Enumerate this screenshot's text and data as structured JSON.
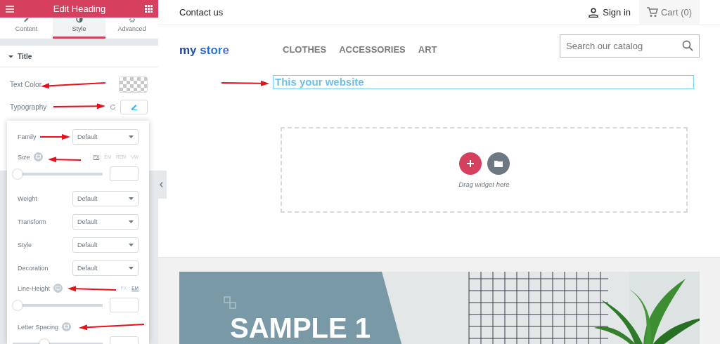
{
  "panel": {
    "title": "Edit Heading",
    "tabs": [
      {
        "label": "Content",
        "selected": false
      },
      {
        "label": "Style",
        "selected": true
      },
      {
        "label": "Advanced",
        "selected": false
      }
    ],
    "section": {
      "title": "Title",
      "expanded": true
    },
    "fields": [
      {
        "kind": "color",
        "label": "Text Color"
      },
      {
        "kind": "typography",
        "label": "Typography"
      }
    ],
    "typography": [
      {
        "kind": "select",
        "label": "Family",
        "value": "Default"
      },
      {
        "kind": "slider",
        "label": "Size",
        "units": [
          {
            "label": "PX",
            "selected": true
          },
          {
            "label": "EM",
            "selected": false
          },
          {
            "label": "REM",
            "selected": false
          },
          {
            "label": "VW",
            "selected": false
          }
        ],
        "level": 0
      },
      {
        "kind": "select",
        "label": "Weight",
        "value": "Default"
      },
      {
        "kind": "select",
        "label": "Transform",
        "value": "Default"
      },
      {
        "kind": "select",
        "label": "Style",
        "value": "Default"
      },
      {
        "kind": "select",
        "label": "Decoration",
        "value": "Default"
      },
      {
        "kind": "slider",
        "label": "Line-Height",
        "units": [
          {
            "label": "PX",
            "selected": false
          },
          {
            "label": "EM",
            "selected": true
          }
        ],
        "level": 0
      },
      {
        "kind": "slider",
        "label": "Letter Spacing",
        "level": 0.33
      }
    ]
  },
  "store": {
    "top_bar": {
      "contact": "Contact us",
      "sign_in": "Sign in",
      "cart": "Cart (0)"
    },
    "logo": "my store",
    "menu": [
      "CLOTHES",
      "ACCESSORIES",
      "ART"
    ],
    "search": {
      "placeholder": "Search our catalog"
    },
    "heading": {
      "text": "This your website",
      "selected": true
    },
    "drop_zone": {
      "hint": "Drag widget here"
    },
    "banner": {
      "title": "SAMPLE 1"
    }
  }
}
